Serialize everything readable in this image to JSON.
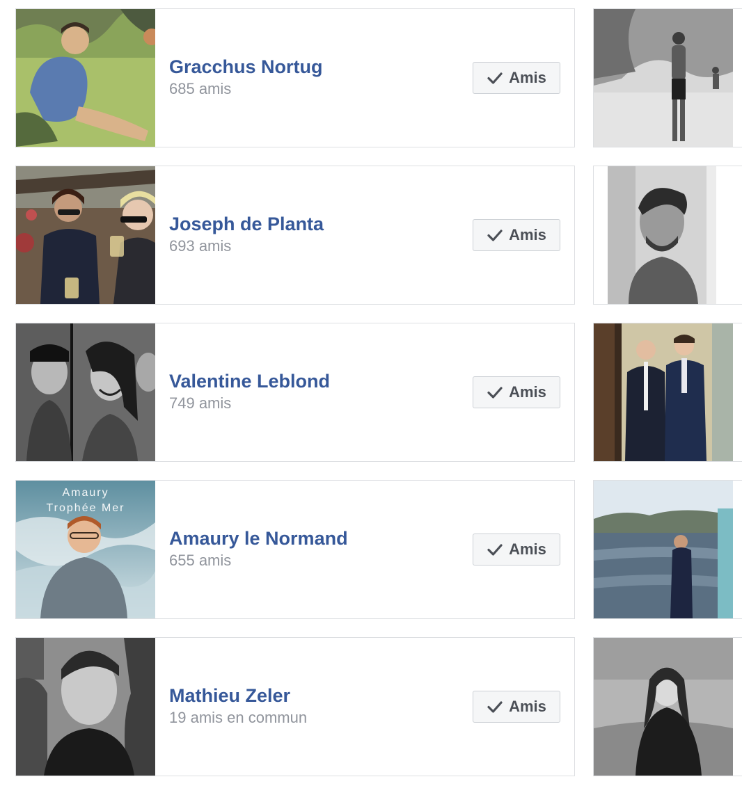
{
  "friends": [
    {
      "name": "Gracchus Nortug",
      "count": "685 amis",
      "button_label": "Amis",
      "check_icon": "check-icon",
      "thumb_icon": "illustration-photo",
      "side_icon": "beach-bw-photo"
    },
    {
      "name": "Joseph de Planta",
      "count": "693 amis",
      "button_label": "Amis",
      "check_icon": "check-icon",
      "thumb_icon": "party-photo",
      "side_icon": "portrait-bw-photo"
    },
    {
      "name": "Valentine Leblond",
      "count": "749 amis",
      "button_label": "Amis",
      "check_icon": "check-icon",
      "thumb_icon": "photobooth-bw-photo",
      "side_icon": "suits-photo"
    },
    {
      "name": "Amaury le Normand",
      "count": "655 amis",
      "button_label": "Amis",
      "check_icon": "check-icon",
      "thumb_icon": "album-cover-photo",
      "thumb_caption_1": "Amaury",
      "thumb_caption_2": "Trophée Mer",
      "side_icon": "lake-photo"
    },
    {
      "name": "Mathieu Zeler",
      "count": "19 amis en commun",
      "button_label": "Amis",
      "check_icon": "check-icon",
      "thumb_icon": "selfie-bw-photo",
      "side_icon": "grass-bw-photo"
    }
  ],
  "colors": {
    "link": "#365899",
    "secondary_text": "#90949c",
    "border": "#dddfe2",
    "button_bg": "#f5f6f7",
    "button_text": "#4b4f56"
  }
}
